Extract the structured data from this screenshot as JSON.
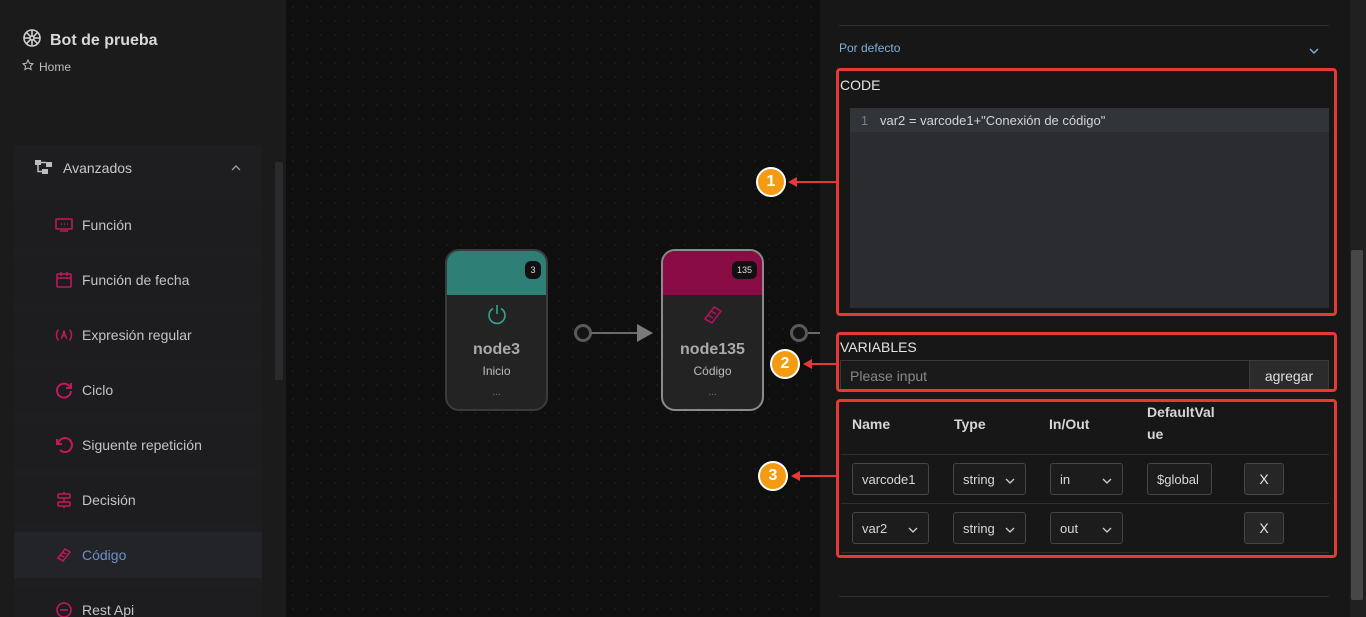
{
  "app": {
    "title": "Bot de prueba",
    "home": "Home"
  },
  "sidebar": {
    "group_label": "Avanzados",
    "items": [
      {
        "label": "Función",
        "icon": "function-icon"
      },
      {
        "label": "Función de fecha",
        "icon": "calendar-icon"
      },
      {
        "label": "Expresión regular",
        "icon": "regex-icon"
      },
      {
        "label": "Ciclo",
        "icon": "loop-icon"
      },
      {
        "label": "Siguente repetición",
        "icon": "undo-icon"
      },
      {
        "label": "Decisión",
        "icon": "decision-icon"
      },
      {
        "label": "Código",
        "icon": "code-icon",
        "active": true
      },
      {
        "label": "Rest Api",
        "icon": "rest-api-icon"
      }
    ]
  },
  "canvas": {
    "nodes": [
      {
        "name": "node3",
        "type": "Inicio",
        "badge": "3",
        "dots": "...",
        "color": "#2e7f75",
        "icon": "power-icon"
      },
      {
        "name": "node135",
        "type": "Código",
        "badge": "135",
        "dots": "...",
        "color": "#8a0c45",
        "icon": "code-icon"
      }
    ]
  },
  "panel": {
    "section": "Por defecto",
    "code_label": "CODE",
    "code_line_number": "1",
    "code_text": "var2 = varcode1+\"Conexión de código\"",
    "variables_label": "VARIABLES",
    "variables_placeholder": "Please input",
    "add_button": "agregar",
    "table": {
      "headers": {
        "name": "Name",
        "type": "Type",
        "inout": "In/Out",
        "default_line1": "DefaultVal",
        "default_line2": "ue"
      },
      "rows": [
        {
          "name": "varcode1",
          "type": "string",
          "inout": "in",
          "default": "$global",
          "remove": "X"
        },
        {
          "name": "var2",
          "type": "string",
          "inout": "out",
          "default": "",
          "remove": "X"
        }
      ]
    }
  },
  "annotations": {
    "m1": "1",
    "m2": "2",
    "m3": "3"
  },
  "colors": {
    "annotation_red": "#e53935",
    "annotation_marker": "#f39c12",
    "link_blue": "#7fb0de",
    "active_menu": "#6f8fcf",
    "icon_pink": "#c2185b"
  }
}
